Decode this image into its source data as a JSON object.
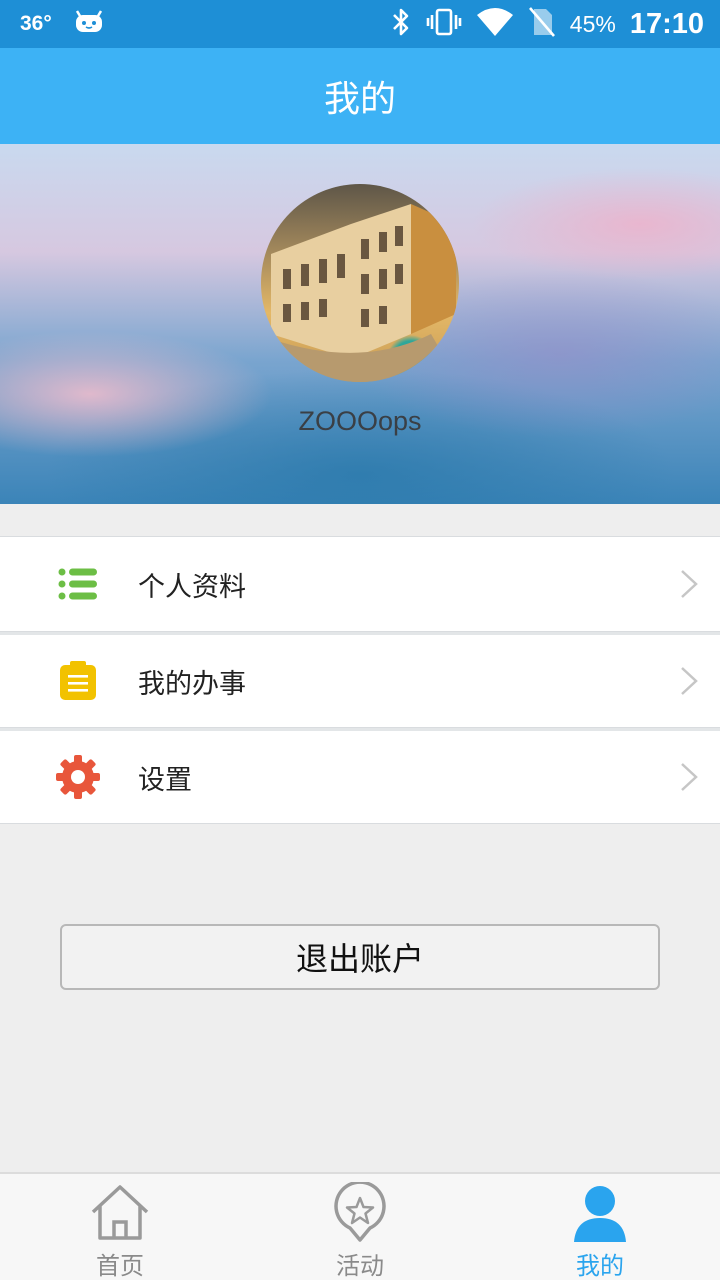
{
  "status_bar": {
    "temperature": "36°",
    "battery": "45%",
    "time": "17:10",
    "icons": [
      "bluetooth-icon",
      "vibrate-icon",
      "wifi-icon",
      "no-sim-icon"
    ]
  },
  "title_bar": {
    "title": "我的"
  },
  "profile": {
    "username": "ZOOOops"
  },
  "menu": {
    "items": [
      {
        "label": "个人资料",
        "icon": "list-icon",
        "icon_color": "#6cbe45"
      },
      {
        "label": "我的办事",
        "icon": "clipboard-icon",
        "icon_color": "#f2c200"
      },
      {
        "label": "设置",
        "icon": "gear-icon",
        "icon_color": "#e8563b"
      }
    ]
  },
  "logout": {
    "label": "退出账户"
  },
  "bottom_nav": {
    "items": [
      {
        "label": "首页",
        "icon": "home-icon"
      },
      {
        "label": "活动",
        "icon": "star-pin-icon"
      },
      {
        "label": "我的",
        "icon": "user-icon",
        "active": true
      }
    ]
  },
  "colors": {
    "status_bar": "#1e8fd6",
    "title_bar": "#3db2f5",
    "accent": "#2aa4ee",
    "background": "#eeeeee"
  }
}
